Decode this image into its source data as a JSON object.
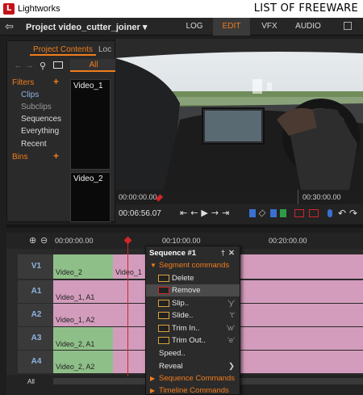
{
  "titlebar": {
    "app_name": "Lightworks",
    "watermark": "LIST OF FREEWARE"
  },
  "topbar": {
    "project": "Project video_cutter_joiner ▾",
    "tabs": [
      {
        "label": "LOG"
      },
      {
        "label": "EDIT",
        "active": true
      },
      {
        "label": "VFX"
      },
      {
        "label": "AUDIO"
      }
    ]
  },
  "content_panel": {
    "tab_project": "Project Contents",
    "tab_other": "Loc",
    "all_tab": "All",
    "filters": "Filters",
    "items": [
      "Clips",
      "Subclips",
      "Sequences",
      "Everything",
      "Recent"
    ],
    "bins": "Bins",
    "bin_clips": [
      "Video_1",
      "Video_2"
    ]
  },
  "viewer": {
    "tc_start": "00:00:00.00",
    "tc_mid": "00:30:00.00",
    "current_time": "00:06:56.07"
  },
  "timeline": {
    "ruler": [
      "00:00:00.00",
      "00:10:00.00",
      "00:20:00.00"
    ],
    "tracks": [
      "V1",
      "A1",
      "A2",
      "A3",
      "A4"
    ],
    "all_label": "All",
    "clips": {
      "v1_a": "Video_2",
      "v1_b": "Video_1",
      "a1": "Video_1, A1",
      "a2": "Video_1, A2",
      "a3": "Video_2, A1",
      "a4": "Video_2, A2"
    }
  },
  "context_menu": {
    "title": "Sequence #1",
    "segment_commands": "Segment commands",
    "delete": "Delete",
    "remove": "Remove",
    "slip": "Slip..",
    "slip_key": "'y'",
    "slide": "Slide..",
    "slide_key": "'t'",
    "trim_in": "Trim In..",
    "trim_in_key": "'w'",
    "trim_out": "Trim Out..",
    "trim_out_key": "'e'",
    "speed": "Speed..",
    "reveal": "Reveal",
    "sequence_commands": "Sequence Commands",
    "timeline_commands": "Timeline Commands"
  },
  "colors": {
    "accent": "#f07d1c",
    "playhead": "#d0252b",
    "clip_pink": "#d39cbc",
    "clip_green": "#8fbf88"
  }
}
